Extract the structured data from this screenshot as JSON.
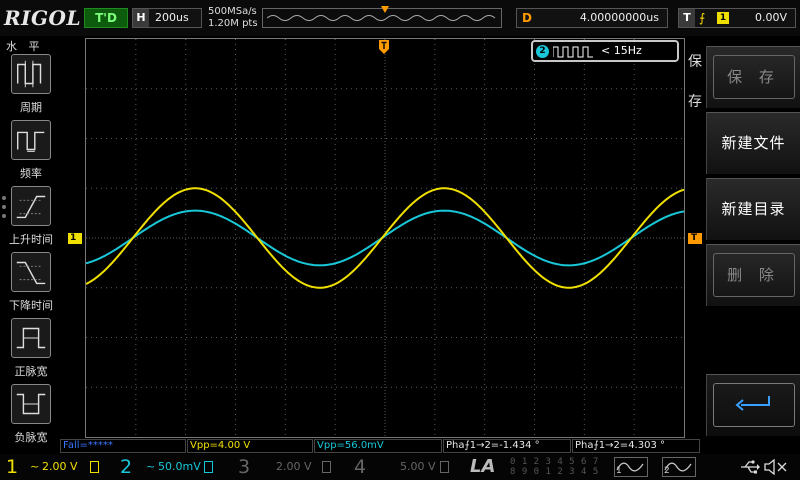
{
  "header": {
    "logo": "RIGOL",
    "run_state": "T'D",
    "horizontal": {
      "tag": "H",
      "timebase": "200us"
    },
    "acquisition": {
      "sample_rate": "500MSa/s",
      "memory_points": "1.20M pts"
    },
    "delay": {
      "tag": "D",
      "value": "4.00000000us"
    },
    "trigger": {
      "tag": "T",
      "edge_symbol": "⨍",
      "source": "1",
      "level": "0.00V"
    }
  },
  "left_menu": {
    "title": "水 平",
    "items": [
      {
        "label": "周期",
        "icon": "period-icon"
      },
      {
        "label": "频率",
        "icon": "frequency-icon"
      },
      {
        "label": "上升时间",
        "icon": "rise-time-icon"
      },
      {
        "label": "下降时间",
        "icon": "fall-time-icon"
      },
      {
        "label": "正脉宽",
        "icon": "positive-width-icon"
      },
      {
        "label": "负脉宽",
        "icon": "negative-width-icon"
      }
    ]
  },
  "waveform": {
    "ch1_marker": "1",
    "trigger_marker": "T",
    "frequency_counter": {
      "channel": "2",
      "value": "< 15Hz"
    },
    "colors": {
      "ch1": "#f0e000",
      "ch2": "#18c8d8",
      "trigger": "#ff9a00",
      "grid": "#5a5a5a"
    },
    "traces": {
      "cycles_visible": 2.4,
      "ch1_amplitude_divisions": 1.0,
      "ch2_amplitude_divisions": 0.55
    }
  },
  "right_menu": {
    "title": "保存",
    "buttons": [
      {
        "label": "保 存",
        "enabled": false
      },
      {
        "label": "新建文件",
        "enabled": true
      },
      {
        "label": "新建目录",
        "enabled": true
      },
      {
        "label": "删 除",
        "enabled": false
      }
    ],
    "back_icon": "return-icon"
  },
  "measurements": [
    {
      "text": "Fall=*****",
      "color": "#3a76ff"
    },
    {
      "text": "Vpp=4.00 V",
      "color": "#f0e000"
    },
    {
      "text": "Vpp=56.0mV",
      "color": "#18c8d8"
    },
    {
      "text": "Pha⨍1→2=-1.434 °",
      "color": "#e8e8e8"
    },
    {
      "text": "Pha⨍1→2=4.303 °",
      "color": "#e8e8e8"
    }
  ],
  "channels": [
    {
      "number": "1",
      "coupling": "~",
      "scale": "2.00 V",
      "color": "#f0e000",
      "active": true
    },
    {
      "number": "2",
      "coupling": "~",
      "scale": "50.0mV",
      "color": "#18c8d8",
      "active": true
    },
    {
      "number": "3",
      "coupling": "",
      "scale": "2.00 V",
      "color": "#666666",
      "active": false
    },
    {
      "number": "4",
      "coupling": "",
      "scale": "5.00 V",
      "color": "#666666",
      "active": false
    }
  ],
  "la": {
    "label": "LA",
    "digits_row1": "0 1 2 3  4 5 6 7",
    "digits_row2": "8 9 0 1  2 3 4 5"
  },
  "generators": [
    "1",
    "2"
  ]
}
